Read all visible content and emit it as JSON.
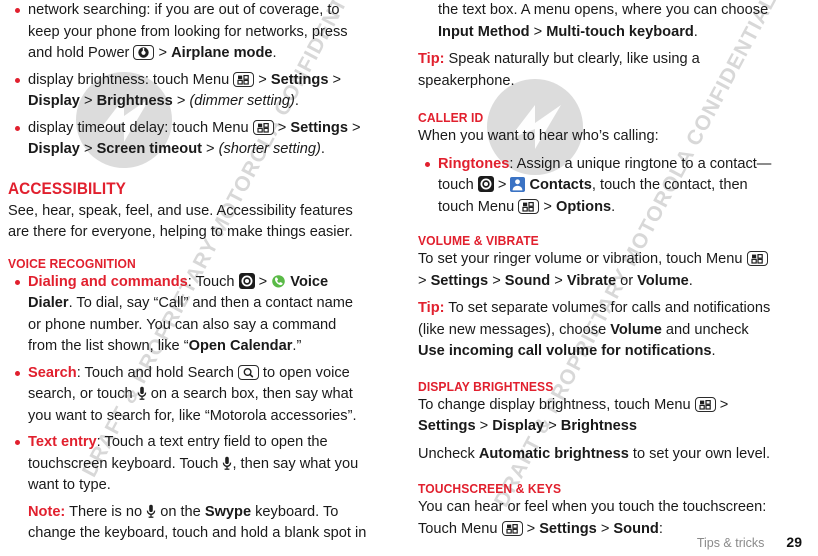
{
  "document": {
    "footer_label": "Tips & tricks",
    "page_number": "29",
    "watermark_text": "DRAFT & PROPRIETARY MOTOROLA CONFIDENTIAL INFORMATION",
    "accent_color": "#e1202e",
    "watermark_color": "#d8d8d8"
  },
  "left_column": {
    "bullets_top": [
      {
        "pre": "network searching: if you are out of coverage, to keep your phone from looking for networks, press and hold Power ",
        "icon": "power-key-icon",
        "mid": " > ",
        "bold": "Airplane mode",
        "post": "."
      },
      {
        "pre": "display brightness: touch Menu ",
        "icon": "menu-key-icon",
        "mid": " > ",
        "bold1": "Settings",
        "sep1": " > ",
        "bold2": "Display",
        "sep2": " > ",
        "bold3": "Brightness",
        "sep3": " > ",
        "italic": "(dimmer setting)",
        "post": "."
      },
      {
        "pre": "display timeout delay: touch Menu ",
        "icon": "menu-key-icon",
        "mid": " > ",
        "bold1": "Settings",
        "sep1": " > ",
        "bold2": "Display",
        "sep2": " > ",
        "bold3": "Screen timeout",
        "sep3": " > ",
        "italic": "(shorter setting)",
        "post": "."
      }
    ],
    "accessibility": {
      "heading": "Accessibility",
      "body": "See, hear, speak, feel, and use. Accessibility features are there for everyone, helping to make things easier."
    },
    "voice_recognition": {
      "heading": "Voice recognition",
      "dialing": {
        "label": "Dialing and commands",
        "t1": ": Touch ",
        "icon1": "app-launcher-icon",
        "t2": " > ",
        "icon2": "voice-dialer-phone-icon",
        "bold1": " Voice Dialer",
        "t3": ". To dial, say “Call” and then a contact name or phone number. You can also say a command from the list shown, like “",
        "bold2": "Open Calendar",
        "t4": ".”"
      },
      "search": {
        "label": "Search",
        "t1": ": Touch and hold Search ",
        "icon1": "search-key-icon",
        "t2": " to open voice search, or touch ",
        "icon2": "microphone-icon",
        "t3": " on a search box, then say what you want to search for, like “Motorola accessories”."
      },
      "text_entry": {
        "label": "Text entry",
        "t1": ": Touch a text entry field to open the touchscreen keyboard. Touch ",
        "icon1": "microphone-icon",
        "t2": ", then say what you want to type."
      },
      "note": {
        "label": "Note:",
        "t1": " There is no ",
        "icon1": "microphone-icon",
        "t2": " on the ",
        "bold1": "Swype",
        "t3": " keyboard. To change the keyboard, touch and hold a blank spot in"
      }
    }
  },
  "right_column": {
    "note_continued": {
      "t1": "the text box. A menu opens, where you can choose ",
      "bold1": "Input Method",
      "t2": " > ",
      "bold2": "Multi-touch keyboard",
      "t3": "."
    },
    "tip_speak": {
      "label": "Tip:",
      "t1": " Speak naturally but clearly, like using a speakerphone."
    },
    "caller_id": {
      "heading": "Caller ID",
      "body": "When you want to hear who’s calling:",
      "ringtones": {
        "label": "Ringtones",
        "t1": ": Assign a unique ringtone to a contact—touch ",
        "icon1": "app-launcher-icon",
        "t2": " > ",
        "icon2": "contacts-icon",
        "bold1": " Contacts",
        "t3": ", touch the contact, then touch Menu ",
        "icon3": "menu-key-icon",
        "t4": " > ",
        "bold2": "Options",
        "t5": "."
      }
    },
    "volume_vibrate": {
      "heading": "Volume & vibrate",
      "t1": "To set your ringer volume or vibration, touch Menu ",
      "icon1": "menu-key-icon",
      "t2": " > ",
      "bold1": "Settings",
      "sep1": " > ",
      "bold2": "Sound",
      "sep2": " > ",
      "bold3": "Vibrate",
      "sep3": " or ",
      "bold4": "Volume",
      "t3": ".",
      "tip": {
        "label": "Tip:",
        "t1": " To set separate volumes for calls and notifications (like new messages), choose ",
        "bold1": "Volume",
        "t2": " and uncheck ",
        "bold2": "Use incoming call volume for notifications",
        "t3": "."
      }
    },
    "display_brightness": {
      "heading": "Display brightness",
      "t1": "To change display brightness, touch Menu ",
      "icon1": "menu-key-icon",
      "t2": " > ",
      "bold1": "Settings",
      "sep1": " > ",
      "bold2": "Display",
      "sep2": " > ",
      "bold3": "Brightness",
      "uncheck_t1": "Uncheck ",
      "uncheck_bold": "Automatic brightness",
      "uncheck_t2": " to set your own level."
    },
    "touchscreen_keys": {
      "heading": "Touchscreen & keys",
      "t1": "You can hear or feel when you touch the touchscreen: Touch Menu ",
      "icon1": "menu-key-icon",
      "t2": " > ",
      "bold1": "Settings",
      "sep1": " > ",
      "bold2": "Sound",
      "t3": ":"
    }
  }
}
